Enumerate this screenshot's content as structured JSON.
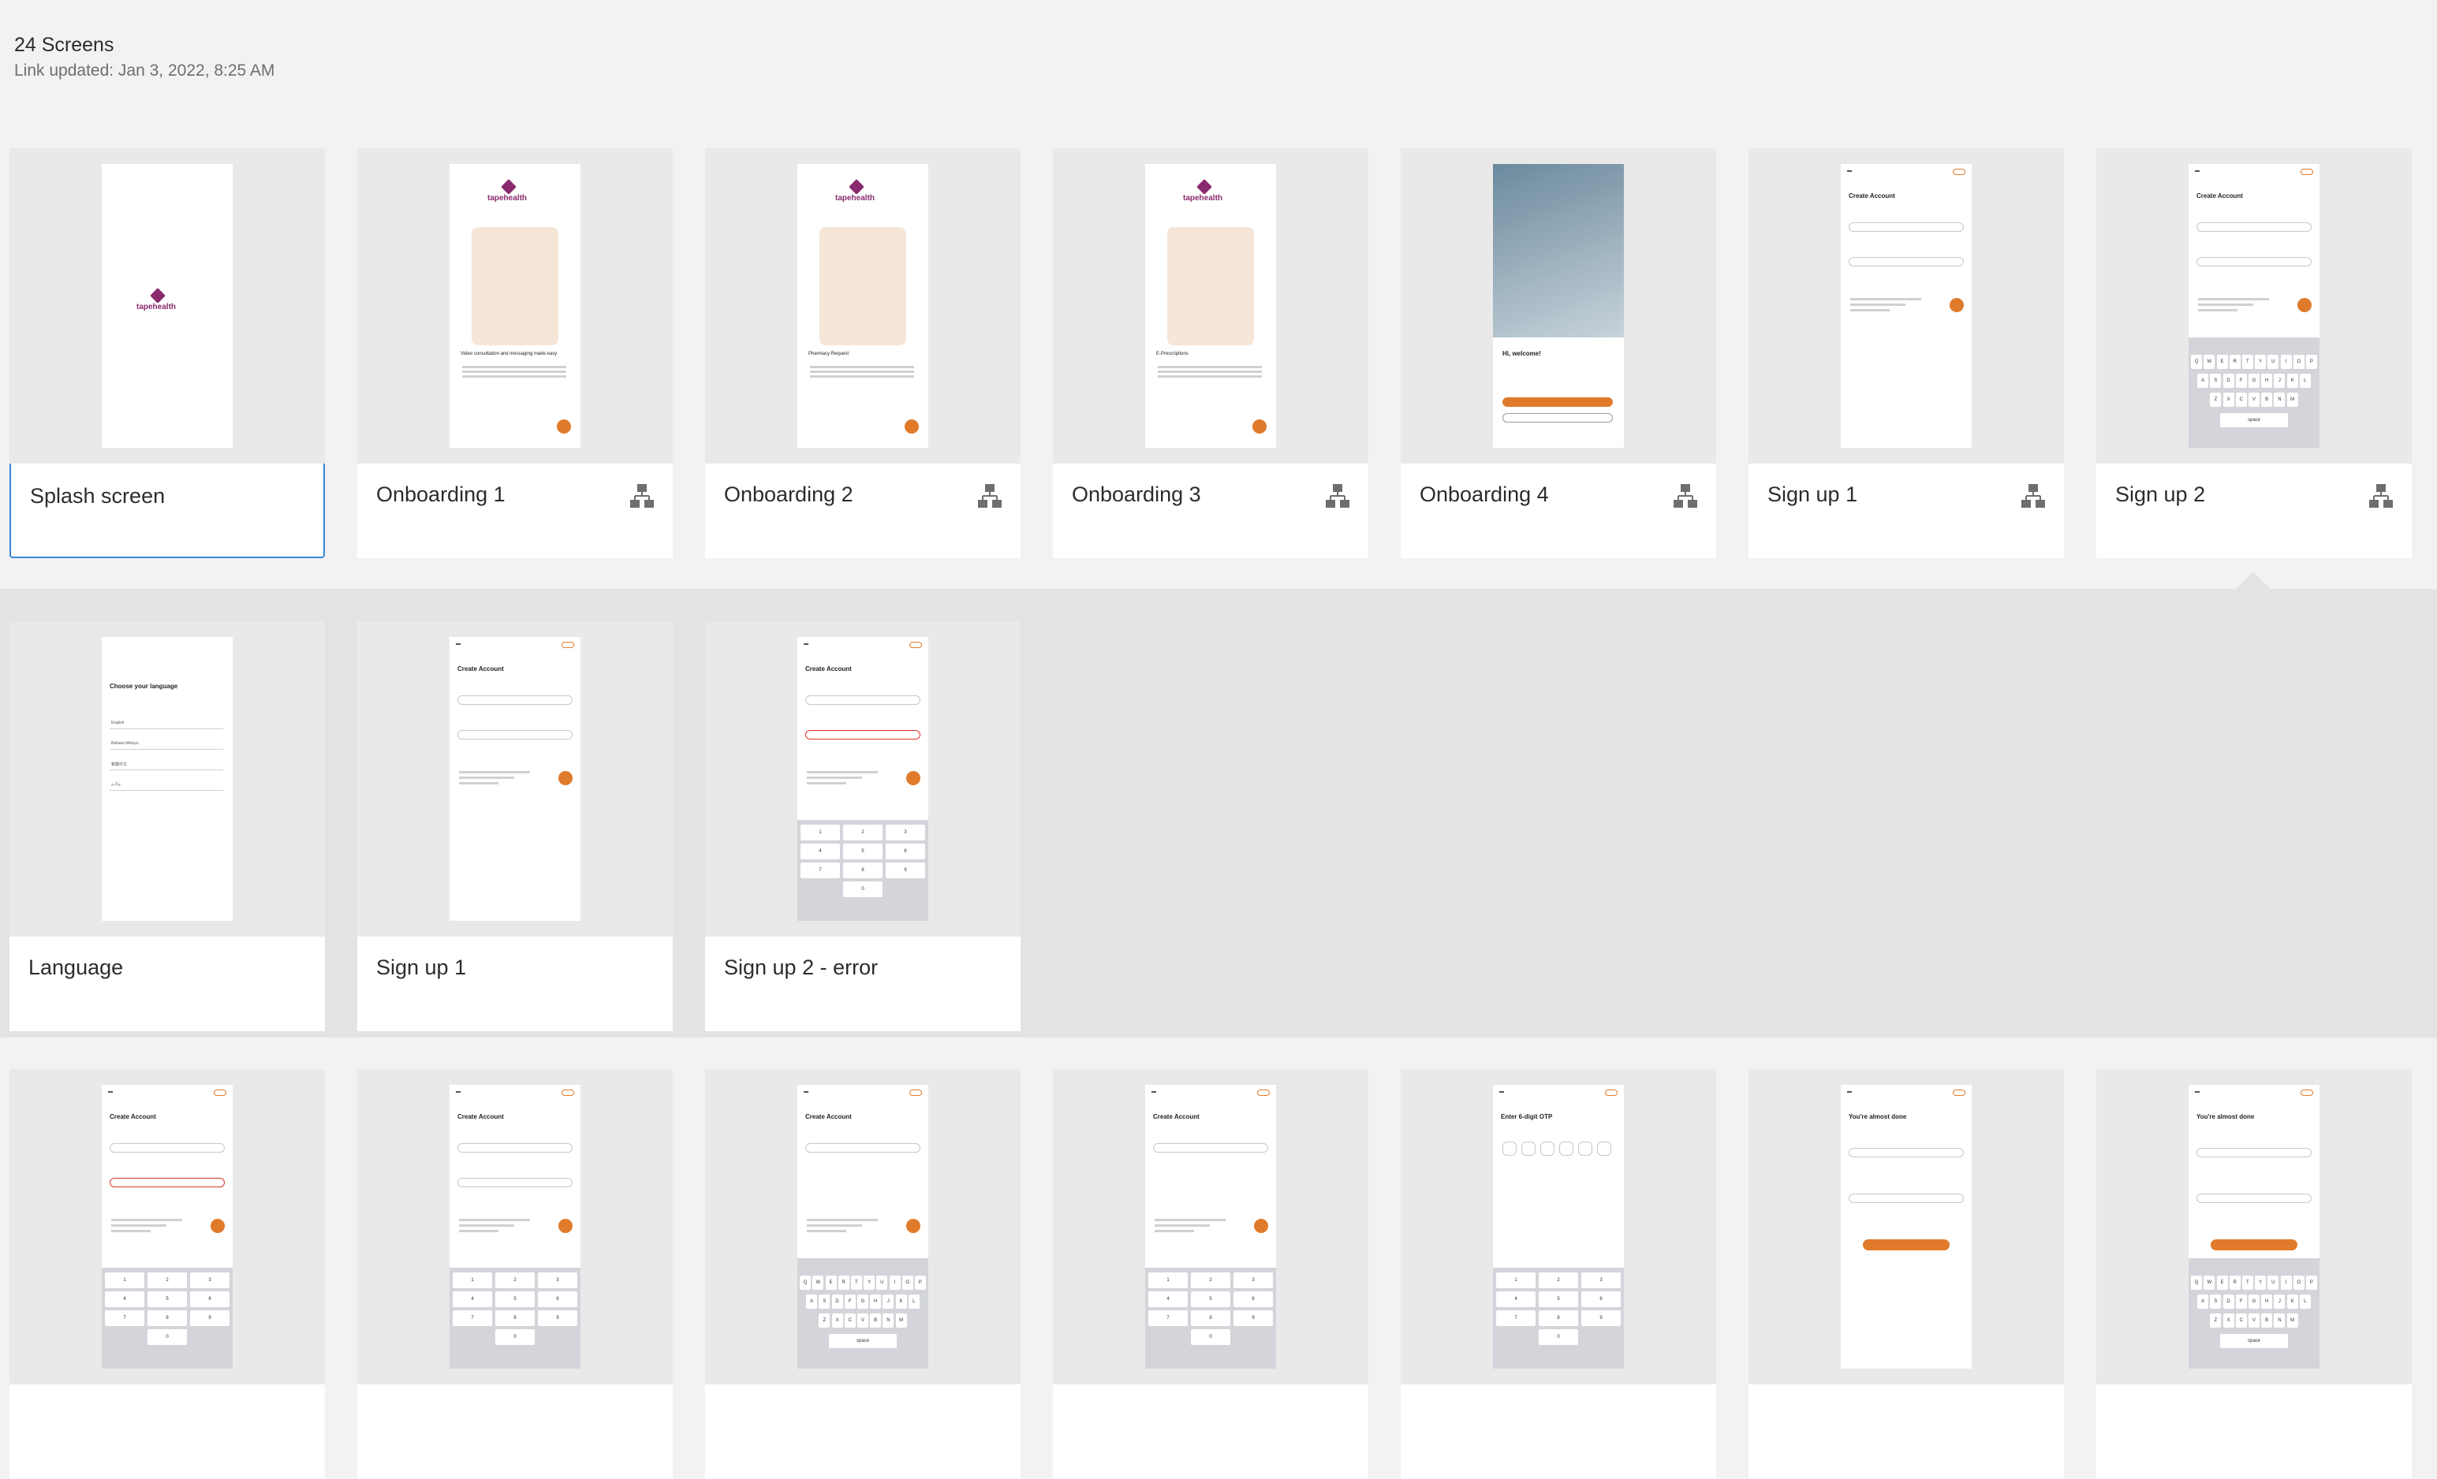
{
  "header": {
    "screen_count": "24 Screens",
    "link_updated": "Link updated: Jan 3, 2022, 8:25 AM"
  },
  "brand": {
    "accent": "#e07b2c",
    "logo_color": "#8a2a6e",
    "selection": "#3a86d4",
    "logo_text": "tapehealth"
  },
  "row1": [
    {
      "label": "Splash screen",
      "has_flow_icon": false,
      "selected": true
    },
    {
      "label": "Onboarding 1",
      "has_flow_icon": true
    },
    {
      "label": "Onboarding 2",
      "has_flow_icon": true
    },
    {
      "label": "Onboarding 3",
      "has_flow_icon": true
    },
    {
      "label": "Onboarding 4",
      "has_flow_icon": true
    },
    {
      "label": "Sign up 1",
      "has_flow_icon": true
    },
    {
      "label": "Sign up 2",
      "has_flow_icon": true
    }
  ],
  "row2": [
    {
      "label": "Language"
    },
    {
      "label": "Sign up 1"
    },
    {
      "label": "Sign up 2 - error"
    }
  ],
  "thumb_text": {
    "video_title": "Video consultation and messaging made easy",
    "pharmacy_title": "Pharmacy Request",
    "eprescription_title": "E-Prescriptions",
    "welcome_title": "Hi, welcome!",
    "create_account": "Create Account",
    "choose_language": "Choose your language",
    "languages": [
      "English",
      "Bahasa Melayu",
      "繁體中文",
      "தமிழ்"
    ],
    "enter_otp": "Enter 6-digit OTP",
    "almost_done": "You're almost done",
    "keyboard_rows": [
      "QWERTYUIOP",
      "ASDFGHJKL",
      "ZXCVBNM"
    ],
    "numpad": [
      "1",
      "2",
      "3",
      "4",
      "5",
      "6",
      "7",
      "8",
      "9",
      "0"
    ],
    "space": "space"
  }
}
